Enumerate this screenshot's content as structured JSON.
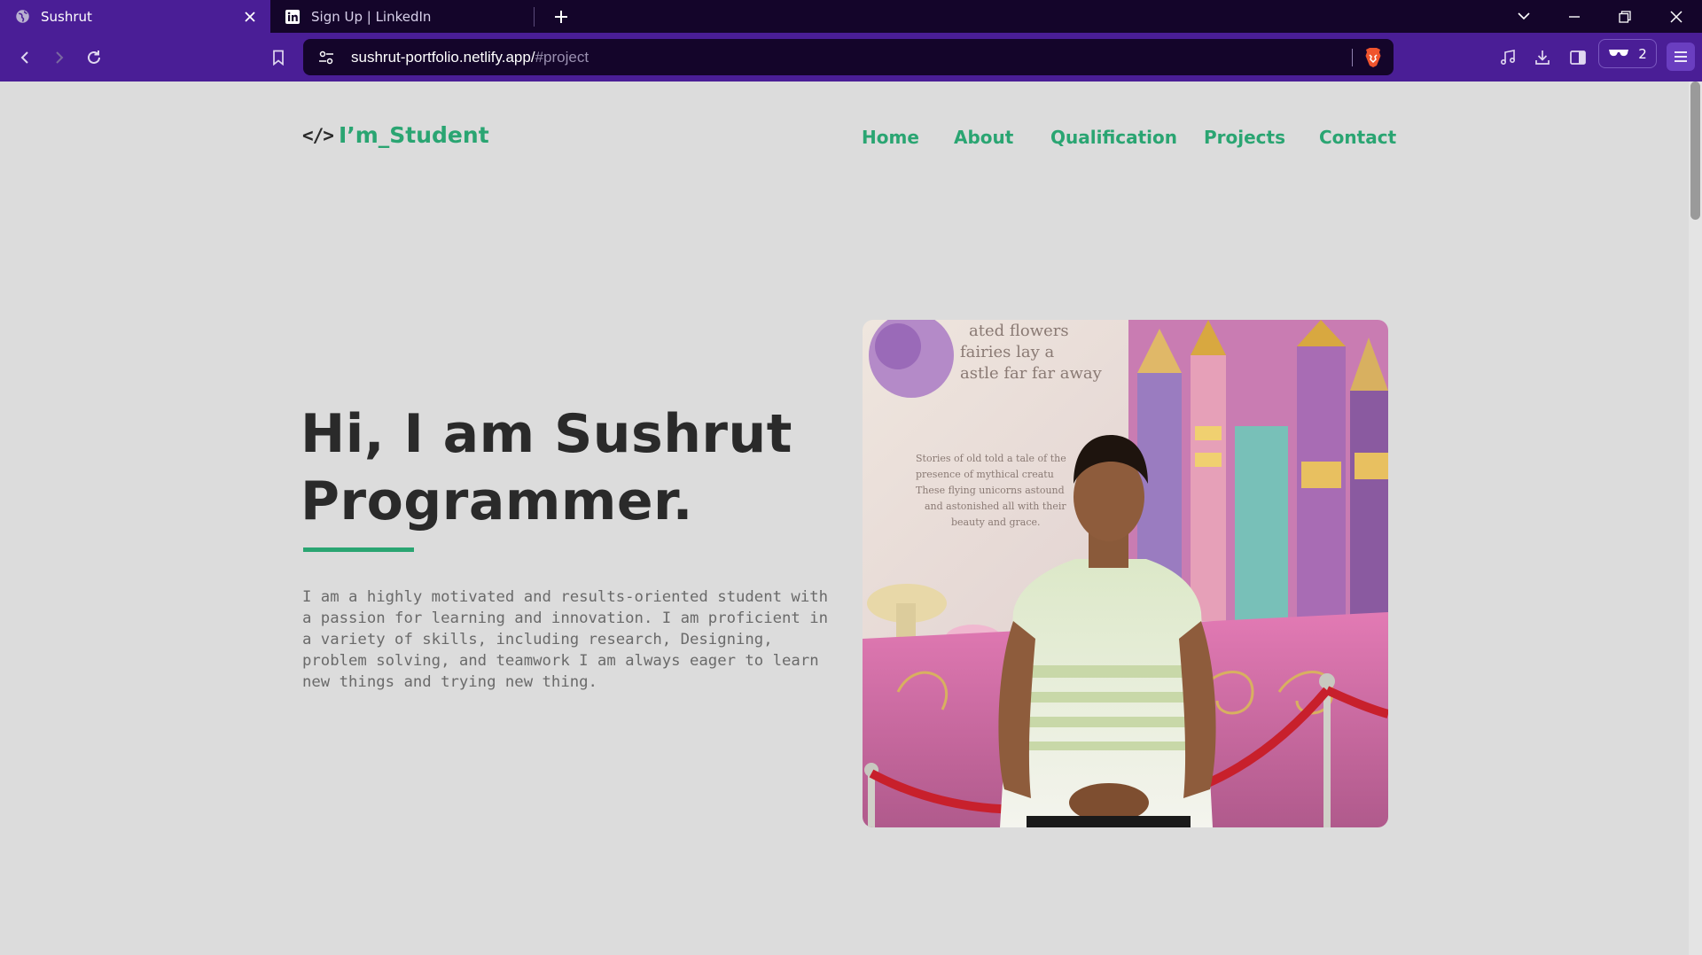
{
  "browser": {
    "tabs": [
      {
        "title": "Sushrut",
        "active": true,
        "icon": "globe-icon"
      },
      {
        "title": "Sign Up | LinkedIn",
        "active": false,
        "icon": "linkedin-icon"
      }
    ],
    "url": {
      "host": "sushrut-portfolio.netlify.app/",
      "path": "#project"
    },
    "vpn_count": "2",
    "colors": {
      "tab_active": "#4a1e96",
      "tabstrip": "#14052a",
      "urlbar": "#14052a"
    }
  },
  "site": {
    "logo": {
      "icon": "</>",
      "text": "I’m_Student"
    },
    "nav": [
      {
        "label": "Home"
      },
      {
        "label": "About"
      },
      {
        "label": "Qualification"
      },
      {
        "label": "Projects"
      },
      {
        "label": "Contact"
      }
    ],
    "hero": {
      "title_line1": "Hi, I am Sushrut",
      "title_line2": "Programmer.",
      "description": "I am a highly motivated and results-oriented student with a passion for learning and innovation. I am proficient in a variety of skills, including research, Designing, problem solving, and teamwork I am always eager to learn new things and trying new thing."
    },
    "colors": {
      "accent": "#2aa572",
      "background": "#dcdcdc",
      "text": "#2a2a2a"
    }
  }
}
